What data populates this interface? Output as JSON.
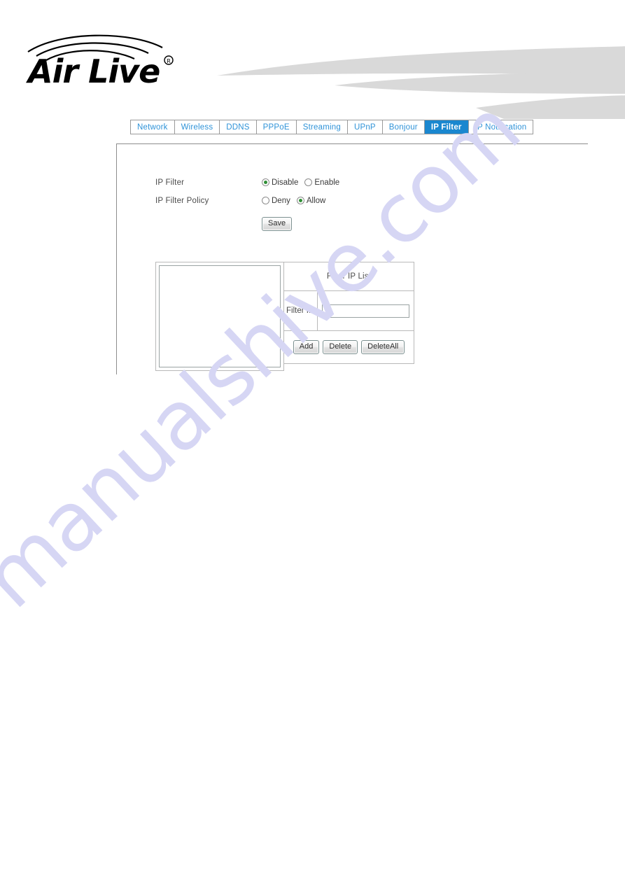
{
  "brand": {
    "name": "AirLive",
    "trademark": "®",
    "logo_name": "airlive-logo"
  },
  "tabs": [
    {
      "id": "network",
      "label": "Network",
      "active": false
    },
    {
      "id": "wireless",
      "label": "Wireless",
      "active": false
    },
    {
      "id": "ddns",
      "label": "DDNS",
      "active": false
    },
    {
      "id": "pppoe",
      "label": "PPPoE",
      "active": false
    },
    {
      "id": "streaming",
      "label": "Streaming",
      "active": false
    },
    {
      "id": "upnp",
      "label": "UPnP",
      "active": false
    },
    {
      "id": "bonjour",
      "label": "Bonjour",
      "active": false
    },
    {
      "id": "ip-filter",
      "label": "IP Filter",
      "active": true
    },
    {
      "id": "ip-notification",
      "label": "IP Notification",
      "active": false
    }
  ],
  "form": {
    "ip_filter": {
      "label": "IP Filter",
      "options": [
        {
          "label": "Disable",
          "checked": true
        },
        {
          "label": "Enable",
          "checked": false
        }
      ]
    },
    "ip_filter_policy": {
      "label": "IP Filter Policy",
      "options": [
        {
          "label": "Deny",
          "checked": false
        },
        {
          "label": "Allow",
          "checked": true
        }
      ]
    },
    "save_label": "Save"
  },
  "filter_panel": {
    "list_title": "Filter IP List",
    "list_items": [],
    "filter_ip_label": "Filter IP",
    "filter_ip_value": "",
    "filter_ip_placeholder": "",
    "buttons": {
      "add": "Add",
      "delete": "Delete",
      "delete_all": "DeleteAll"
    }
  },
  "watermark": {
    "text": "manualshive.com",
    "color": "#d6d6f4"
  },
  "colors": {
    "active_tab": "#1a87cf",
    "tab_text": "#2f93d8",
    "swoosh": "#d9d9d9",
    "radio_dot": "#2f8f36"
  }
}
